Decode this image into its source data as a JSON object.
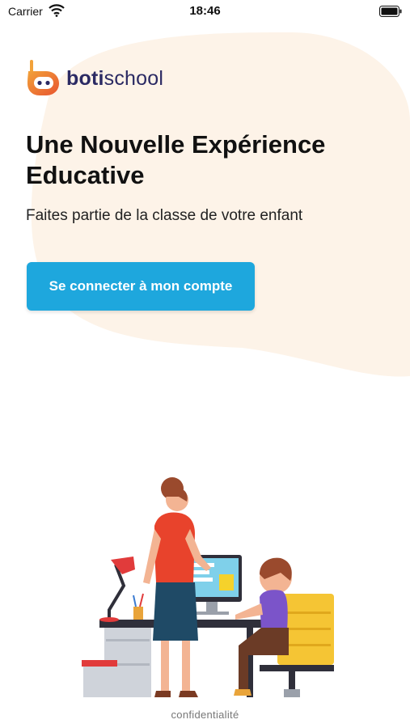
{
  "status_bar": {
    "carrier": "Carrier",
    "time": "18:46"
  },
  "brand": {
    "name_bold": "boti",
    "name_regular": "school",
    "logo_colors": [
      "#e8542f",
      "#f2a23a"
    ]
  },
  "hero": {
    "headline": "Une Nouvelle Expérience Educative",
    "subtitle": "Faites partie de la classe de votre enfant"
  },
  "actions": {
    "login_label": "Se connecter à mon compte"
  },
  "footer": {
    "privacy_label": "confidentialité"
  },
  "colors": {
    "accent": "#1ea7dd",
    "background_blob": "#fdf3e8",
    "brand_text": "#2b2a63"
  },
  "icons": [
    "wifi-icon",
    "battery-icon",
    "robot-logo-icon",
    "teacher-student-illustration"
  ]
}
